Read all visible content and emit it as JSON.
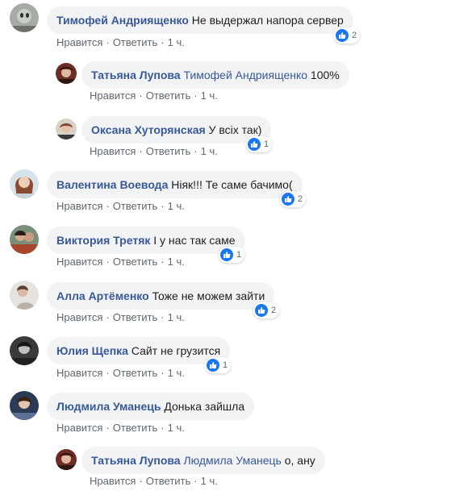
{
  "labels": {
    "like": "Нравится",
    "reply": "Ответить"
  },
  "colors": {
    "link": "#385898",
    "bubble": "#f2f3f5",
    "like": "#1877f2"
  },
  "comments": [
    {
      "author": "Тимофей Андриященко",
      "mention": "",
      "text": "Не выдержал напора сервер",
      "time": "1 ч.",
      "likes": "2"
    },
    {
      "author": "Татьяна Лупова",
      "mention": "Тимофей Андриященко",
      "text": "100%",
      "time": "1 ч.",
      "likes": ""
    },
    {
      "author": "Оксана Хуторянская",
      "mention": "",
      "text": "У всіх так)",
      "time": "1 ч.",
      "likes": "1"
    },
    {
      "author": "Валентина Воевода",
      "mention": "",
      "text": "Ніяк!!! Те саме бачимо(",
      "time": "1 ч.",
      "likes": "2"
    },
    {
      "author": "Виктория Третяк",
      "mention": "",
      "text": "І у нас так саме",
      "time": "1 ч.",
      "likes": "1"
    },
    {
      "author": "Алла Артёменко",
      "mention": "",
      "text": "Тоже не можем зайти",
      "time": "1 ч.",
      "likes": "2"
    },
    {
      "author": "Юлия Щепка",
      "mention": "",
      "text": "Сайт не грузится",
      "time": "1 ч.",
      "likes": "1"
    },
    {
      "author": "Людмила Уманець",
      "mention": "",
      "text": "Донька зайшла",
      "time": "1 ч.",
      "likes": ""
    },
    {
      "author": "Татьяна Лупова",
      "mention": "Людмила Уманець",
      "text": "о, ану",
      "time": "1 ч.",
      "likes": ""
    }
  ]
}
